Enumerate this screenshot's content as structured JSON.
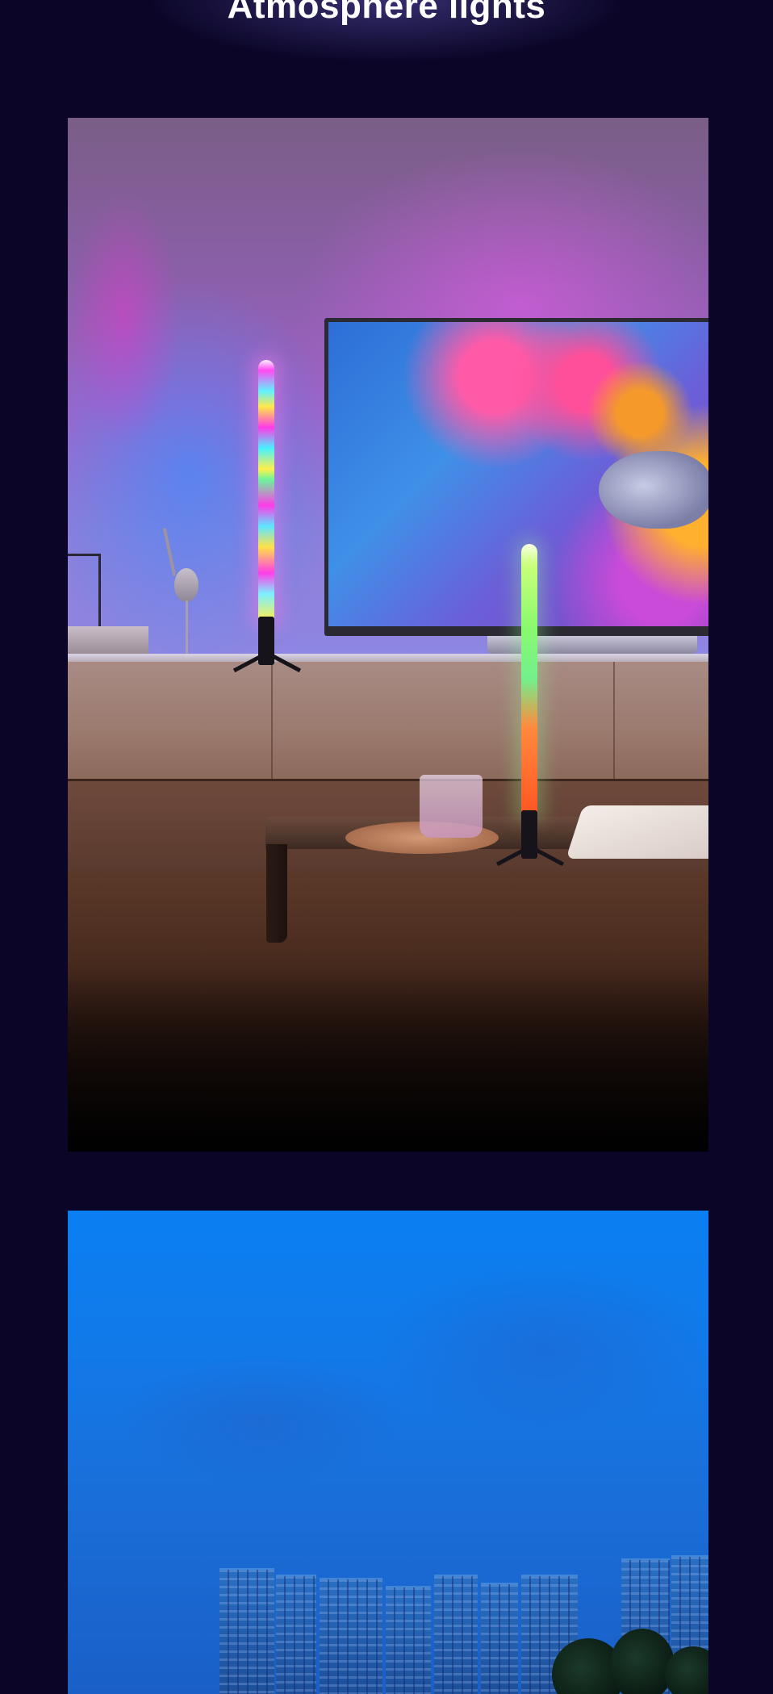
{
  "page": {
    "title": "Atmosphere lights",
    "background_color": "#0b0628"
  },
  "images": [
    {
      "name": "living-room-atmosphere-lights-image",
      "alt": ""
    },
    {
      "name": "city-skyline-dusk-image",
      "alt": ""
    }
  ]
}
